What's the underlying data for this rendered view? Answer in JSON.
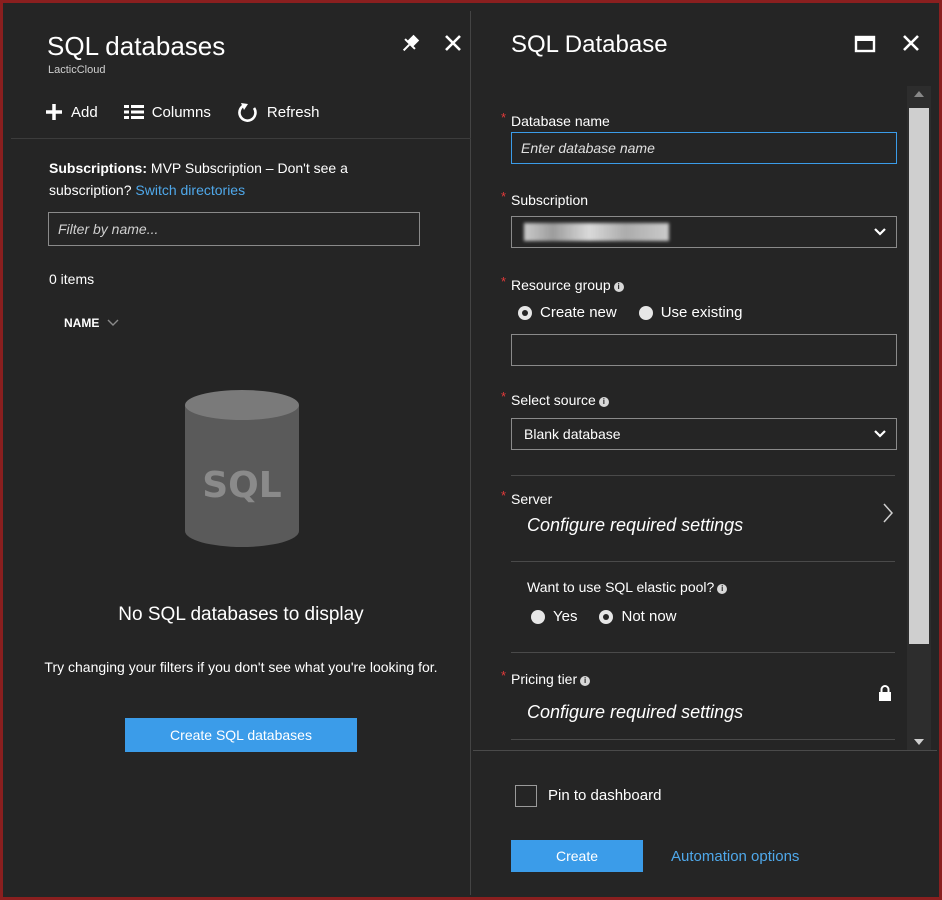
{
  "left_blade": {
    "title": "SQL databases",
    "subtitle": "LacticCloud",
    "commands": {
      "add": "Add",
      "columns": "Columns",
      "refresh": "Refresh"
    },
    "subscriptions_label": "Subscriptions:",
    "subscriptions_text": " MVP Subscription – Don't see a subscription? ",
    "switch_directories": "Switch directories",
    "filter_placeholder": "Filter by name...",
    "items_count": "0 items",
    "name_column": "NAME",
    "empty_icon_text": "SQL",
    "empty_title": "No SQL databases to display",
    "empty_description": "Try changing your filters if you don't see what you're looking for.",
    "create_button": "Create SQL databases"
  },
  "right_blade": {
    "title": "SQL Database",
    "database_name": {
      "label": "Database name",
      "placeholder": "Enter database name"
    },
    "subscription": {
      "label": "Subscription"
    },
    "resource_group": {
      "label": "Resource group",
      "options": [
        "Create new",
        "Use existing"
      ],
      "selected": "Create new"
    },
    "select_source": {
      "label": "Select source",
      "value": "Blank database"
    },
    "server": {
      "label": "Server",
      "value": "Configure required settings"
    },
    "elastic_pool": {
      "label": "Want to use SQL elastic pool?",
      "options": [
        "Yes",
        "Not now"
      ],
      "selected": "Not now"
    },
    "pricing_tier": {
      "label": "Pricing tier",
      "value": "Configure required settings"
    },
    "pin_to_dashboard": "Pin to dashboard",
    "create_button": "Create",
    "automation_link": "Automation options"
  },
  "colors": {
    "background": "#252525",
    "accent_blue": "#3b9ce9",
    "link_blue": "#4fa8ea",
    "required_star": "#e43a3a",
    "frame_border": "#8a1f1f"
  }
}
